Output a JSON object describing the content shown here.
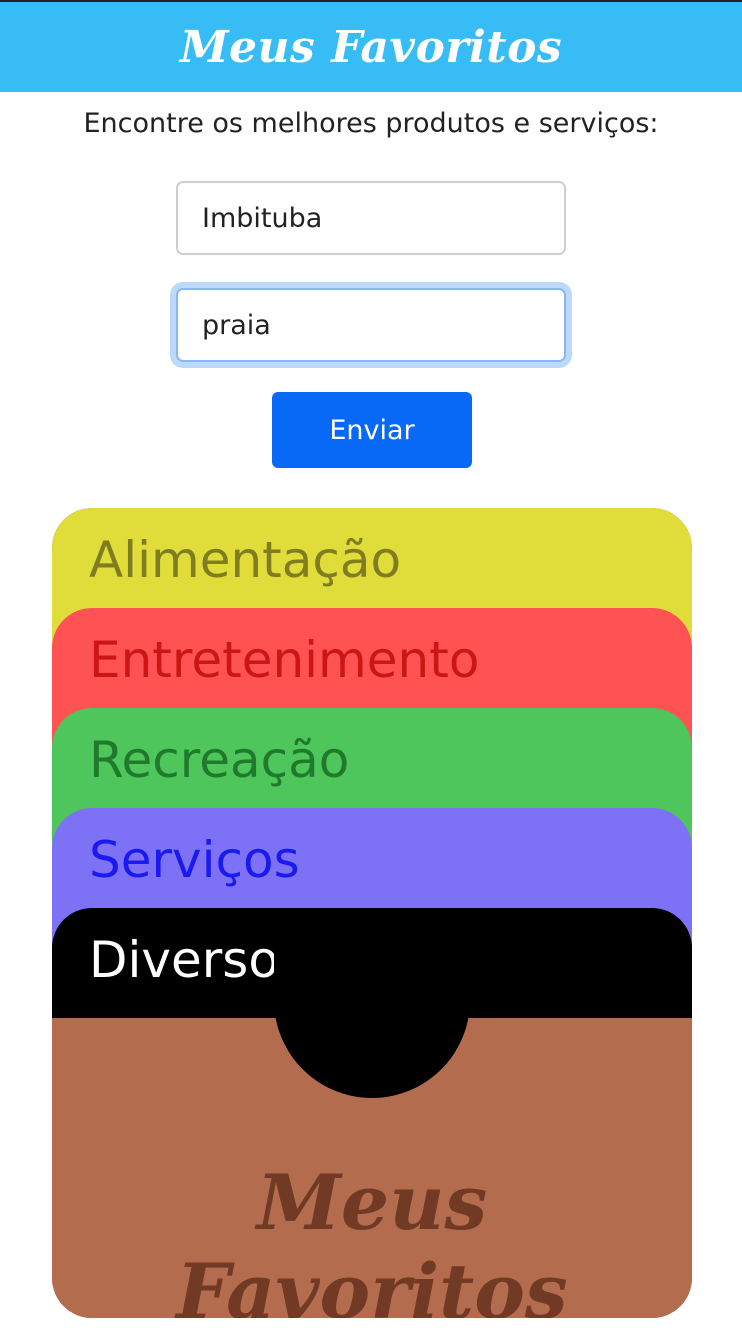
{
  "header": {
    "title": "Meus Favoritos"
  },
  "intro": {
    "text": "Encontre os melhores produtos e serviços:"
  },
  "form": {
    "city_value": "Imbituba",
    "search_value": "praia",
    "submit_label": "Enviar"
  },
  "categories": [
    {
      "label": "Alimentação",
      "bg": "#e0dd3b",
      "fg": "#7f7d1f"
    },
    {
      "label": "Entretenimento",
      "bg": "#ff5353",
      "fg": "#cc1616"
    },
    {
      "label": "Recreação",
      "bg": "#4ec65b",
      "fg": "#1f7a2b"
    },
    {
      "label": "Serviços",
      "bg": "#7d72f5",
      "fg": "#1a1af0"
    },
    {
      "label": "Diversos",
      "bg": "#000000",
      "fg": "#ffffff"
    }
  ],
  "footer": {
    "logo_text": "Meus Favoritos",
    "bg": "#b46c4e",
    "fg": "#713a25"
  }
}
